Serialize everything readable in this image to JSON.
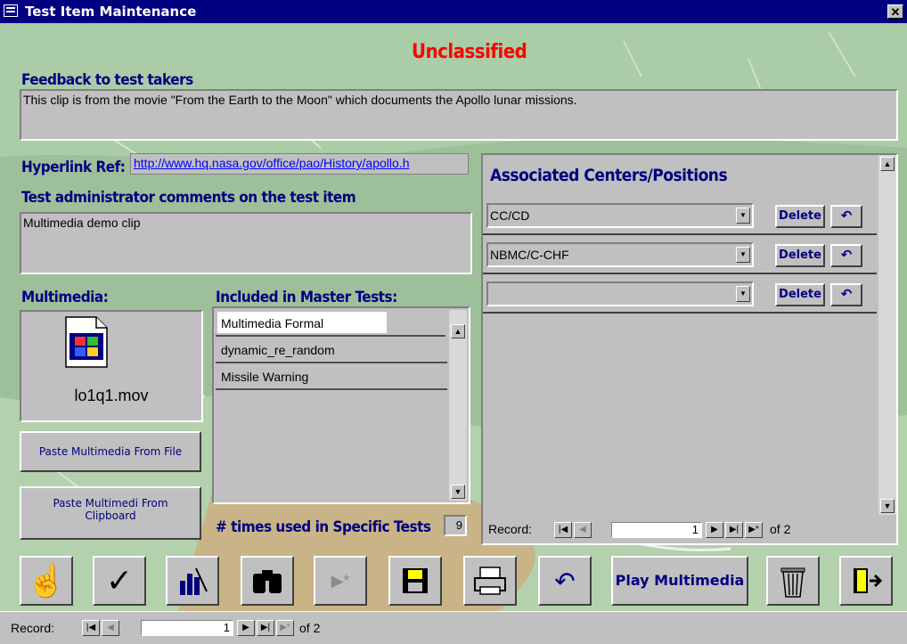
{
  "window": {
    "title": "Test Item Maintenance",
    "close_glyph": "✕"
  },
  "classification": {
    "text": "Unclassified",
    "color": "#ff0000"
  },
  "feedback": {
    "label": "Feedback to test takers",
    "value": "This clip is from the movie \"From the Earth to the Moon\" which documents the Apollo lunar missions."
  },
  "hyperlink": {
    "label": "Hyperlink Ref:",
    "value": "http://www.hq.nasa.gov/office/pao/History/apollo.h"
  },
  "admin_comments": {
    "label": "Test administrator comments on the test item",
    "value": "Multimedia demo clip"
  },
  "multimedia": {
    "label": "Multimedia:",
    "filename": "lo1q1.mov",
    "icon": "movie-file-icon"
  },
  "paste_file_button": {
    "label": "Paste Multimedia From File"
  },
  "paste_clip_button": {
    "line1": "Paste Multimedi From",
    "line2": "Clipboard"
  },
  "master_tests": {
    "label": "Included in Master Tests:",
    "items": [
      "Multimedia Formal",
      "dynamic_re_random",
      "Missile Warning"
    ]
  },
  "specific_tests": {
    "label": "# times used in Specific Tests",
    "count": "9"
  },
  "associated": {
    "title": "Associated Centers/Positions",
    "rows": [
      {
        "value": "CC/CD",
        "delete_label": "Delete"
      },
      {
        "value": "NBMC/C-CHF",
        "delete_label": "Delete"
      },
      {
        "value": "",
        "delete_label": "Delete"
      }
    ],
    "record_label": "Record:",
    "record_current": "1",
    "record_of": "of 2"
  },
  "toolbar": {
    "play_label": "Play Multimedia",
    "icons": [
      "pointing-hand-icon",
      "checkmark-icon",
      "chart-icon",
      "binoculars-icon",
      "new-record-icon",
      "save-disk-icon",
      "printer-icon",
      "undo-icon",
      "play-multimedia",
      "trash-can-icon",
      "exit-door-icon"
    ]
  },
  "navigation": {
    "record_label": "Record:",
    "record_current": "1",
    "record_of": "of 2"
  },
  "colors": {
    "title_bar": "#000080",
    "label_text": "#000080",
    "form_bg": "#c0c0c0"
  }
}
